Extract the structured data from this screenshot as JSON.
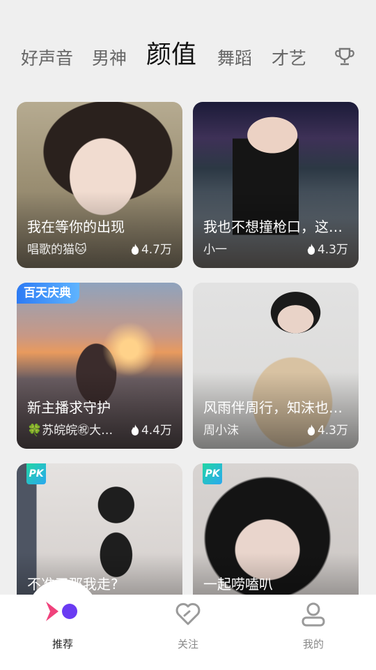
{
  "tabs": [
    {
      "label": "好声音",
      "active": false
    },
    {
      "label": "男神",
      "active": false
    },
    {
      "label": "颜值",
      "active": true
    },
    {
      "label": "舞蹈",
      "active": false
    },
    {
      "label": "才艺",
      "active": false
    }
  ],
  "header": {
    "ranking_icon": "trophy-icon"
  },
  "cards": [
    {
      "title": "我在等你的出现",
      "host": "唱歌的猫🐱",
      "heat": "4.7万",
      "badge": ""
    },
    {
      "title": "我也不想撞枪口，这…",
      "host": "小一",
      "heat": "4.3万",
      "badge": ""
    },
    {
      "title": "新主播求守护",
      "host": "🍀苏皖皖㊗大…",
      "heat": "4.4万",
      "badge": "百天庆典"
    },
    {
      "title": "风雨伴周行，知沫也…",
      "host": "周小沫",
      "heat": "4.3万",
      "badge": ""
    },
    {
      "title": "不准了那我走?",
      "host": "",
      "heat": "",
      "badge": "PK"
    },
    {
      "title": "一起唠嗑叭",
      "host": "",
      "heat": "",
      "badge": "PK"
    }
  ],
  "nav": [
    {
      "label": "推荐",
      "icon": "recommend-logo-icon",
      "active": true
    },
    {
      "label": "关注",
      "icon": "heart-icon",
      "active": false
    },
    {
      "label": "我的",
      "icon": "profile-icon",
      "active": false
    }
  ],
  "colors": {
    "accent_pink": "#f0427c",
    "accent_purple": "#6a3bf2",
    "background": "#efefef"
  }
}
